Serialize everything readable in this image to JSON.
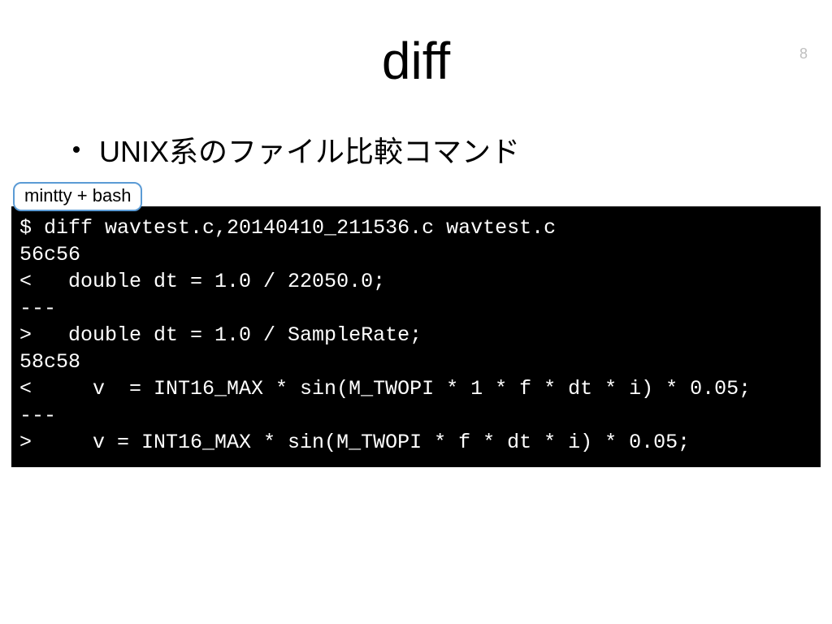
{
  "page_number": "8",
  "title": "diff",
  "bullet": "UNIX系のファイル比較コマンド",
  "tab_label": "mintty + bash",
  "terminal_lines": [
    "$ diff wavtest.c,20140410_211536.c wavtest.c",
    "56c56",
    "<   double dt = 1.0 / 22050.0;",
    "---",
    ">   double dt = 1.0 / SampleRate;",
    "58c58",
    "<     v  = INT16_MAX * sin(M_TWOPI * 1 * f * dt * i) * 0.05;",
    "---",
    ">     v = INT16_MAX * sin(M_TWOPI * f * dt * i) * 0.05;"
  ]
}
